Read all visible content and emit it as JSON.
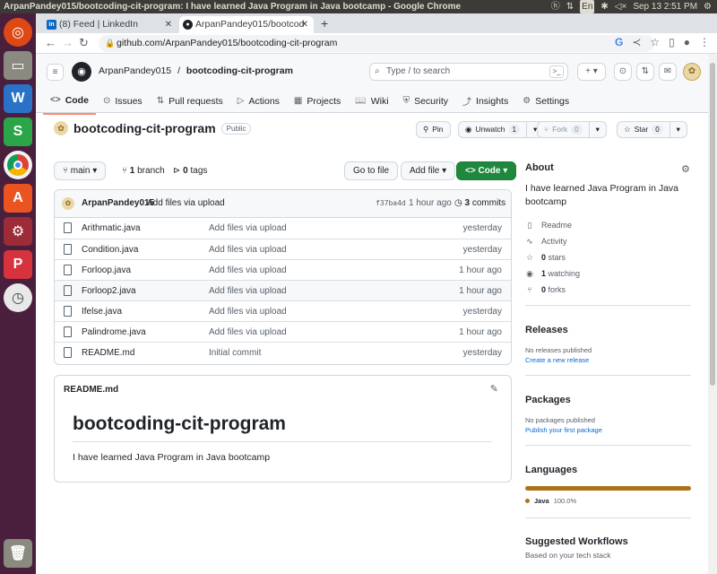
{
  "os": {
    "window_title": "ArpanPandey015/bootcoding-cit-program: I have learned Java Program in Java bootcamp - Google Chrome",
    "lang": "En",
    "clock": "Sep 13  2:51 PM"
  },
  "browser": {
    "tabs": [
      {
        "label": "(8) Feed | LinkedIn",
        "icon": "linkedin-icon"
      },
      {
        "label": "ArpanPandey015/bootcod",
        "icon": "github-icon"
      }
    ],
    "url": "github.com/ArpanPandey015/bootcoding-cit-program"
  },
  "header": {
    "owner": "ArpanPandey015",
    "separator": "/",
    "repo": "bootcoding-cit-program",
    "search_placeholder": "Type / to search",
    "search_shortcut": "/"
  },
  "repo_nav": [
    {
      "label": "Code",
      "icon": "<>"
    },
    {
      "label": "Issues",
      "icon": "⊙"
    },
    {
      "label": "Pull requests",
      "icon": "⇅"
    },
    {
      "label": "Actions",
      "icon": "▷"
    },
    {
      "label": "Projects",
      "icon": "▦"
    },
    {
      "label": "Wiki",
      "icon": "📖"
    },
    {
      "label": "Security",
      "icon": "⛨"
    },
    {
      "label": "Insights",
      "icon": "⤴"
    },
    {
      "label": "Settings",
      "icon": "⚙"
    }
  ],
  "repo": {
    "name": "bootcoding-cit-program",
    "visibility": "Public",
    "pin": "Pin",
    "unwatch": "Unwatch",
    "watch_count": "1",
    "fork": "Fork",
    "fork_count": "0",
    "star": "Star",
    "star_count": "0"
  },
  "branch_bar": {
    "branch": "main",
    "branch_count": "1",
    "branch_word": "branch",
    "tag_count": "0",
    "tag_word": "tags",
    "goto": "Go to file",
    "addfile": "Add file",
    "code": "Code"
  },
  "latest_commit": {
    "author": "ArpanPandey015",
    "message": "Add files via upload",
    "sha": "f37ba4d",
    "age": "1 hour ago",
    "commit_count": "3",
    "commit_word": "commits"
  },
  "files": [
    {
      "name": "Arithmatic.java",
      "message": "Add files via upload",
      "age": "yesterday"
    },
    {
      "name": "Condition.java",
      "message": "Add files via upload",
      "age": "yesterday"
    },
    {
      "name": "Forloop.java",
      "message": "Add files via upload",
      "age": "1 hour ago"
    },
    {
      "name": "Forloop2.java",
      "message": "Add files via upload",
      "age": "1 hour ago"
    },
    {
      "name": "Ifelse.java",
      "message": "Add files via upload",
      "age": "yesterday"
    },
    {
      "name": "Palindrome.java",
      "message": "Add files via upload",
      "age": "1 hour ago"
    },
    {
      "name": "README.md",
      "message": "Initial commit",
      "age": "yesterday"
    }
  ],
  "readme": {
    "filename": "README.md",
    "heading": "bootcoding-cit-program",
    "text": "I have learned Java Program in Java bootcamp"
  },
  "sidebar": {
    "about_title": "About",
    "about_text": "I have learned Java Program in Java bootcamp",
    "readme": "Readme",
    "activity": "Activity",
    "stars_count": "0",
    "stars_word": "stars",
    "watching_count": "1",
    "watching_word": "watching",
    "forks_count": "0",
    "forks_word": "forks",
    "releases_title": "Releases",
    "releases_none": "No releases published",
    "releases_link": "Create a new release",
    "packages_title": "Packages",
    "packages_none": "No packages published",
    "packages_link": "Publish your first package",
    "languages_title": "Languages",
    "language_name": "Java",
    "language_pct": "100.0%",
    "workflows_title": "Suggested Workflows",
    "workflows_sub": "Based on your tech stack"
  },
  "colors": {
    "accent": "#fd8c73",
    "green_button": "#1f883d",
    "java": "#b07219",
    "link": "#0969da"
  }
}
